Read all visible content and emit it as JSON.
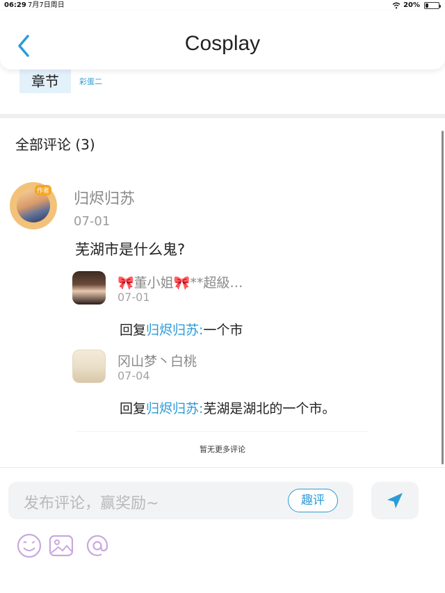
{
  "status_bar": {
    "time": "06:29",
    "date": "7月7日周日",
    "battery": "20%",
    "battery_level": 0.2
  },
  "nav": {
    "title": "Cosplay",
    "back_icon": "chevron-left-icon"
  },
  "chapter": {
    "tab_label": "章节",
    "link_label": "彩蛋二"
  },
  "comments": {
    "header": "全部评论 (3)",
    "main": {
      "badge": "作者",
      "author": "归烬归苏",
      "date": "07-01",
      "text": "芜湖市是什么鬼?"
    },
    "replies": [
      {
        "name": "🎀董小姐🎀**超級…",
        "date": "07-01",
        "prefix": "回复",
        "target": "归烬归苏:",
        "text": "一个市"
      },
      {
        "name": "冈山梦丶白桃",
        "date": "07-04",
        "prefix": "回复",
        "target": "归烬归苏:",
        "text": "芜湖是湖北的一个市。"
      }
    ],
    "no_more": "暂无更多评论"
  },
  "input": {
    "placeholder": "发布评论，赢奖励~",
    "quping_label": "趣评",
    "send_icon": "send-icon"
  },
  "toolbar": {
    "icons": [
      "emoji-icon",
      "image-icon",
      "at-icon"
    ]
  },
  "colors": {
    "accent": "#2a9bd8",
    "toolbar_icon": "#c7a8e0",
    "secondary_text": "#8a8a8a"
  }
}
